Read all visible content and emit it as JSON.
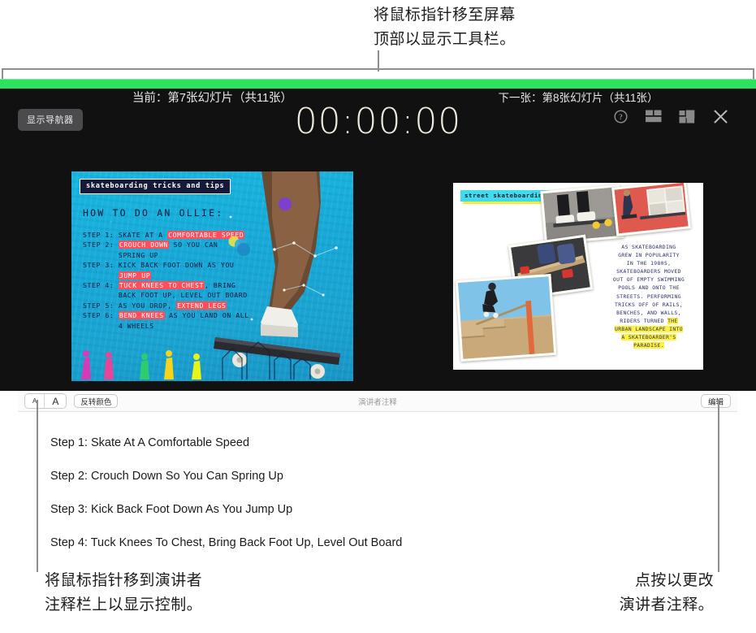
{
  "callouts": {
    "top": [
      "将鼠标指针移至屏幕",
      "顶部以显示工具栏。"
    ],
    "bottom_left": [
      "将鼠标指针移到演讲者",
      "注释栏上以显示控制。"
    ],
    "bottom_right": [
      "点按以更改",
      "演讲者注释。"
    ]
  },
  "toolbar": {
    "show_navigator_label": "显示导航器",
    "timer": "00:00:00",
    "icons": [
      {
        "name": "help-icon",
        "label": "帮助"
      },
      {
        "name": "layout-icon",
        "label": "布局"
      },
      {
        "name": "layout-options-icon",
        "label": "布局选项"
      },
      {
        "name": "close-icon",
        "label": "关闭"
      }
    ]
  },
  "slides": {
    "current_label": "当前：第7张幻灯片（共11张）",
    "next_label": "下一张：第8张幻灯片（共11张）",
    "current": {
      "title": "skateboarding tricks and tips",
      "heading": "HOW TO DO AN OLLIE:",
      "steps": [
        {
          "prefix": "STEP 1: ",
          "parts": [
            {
              "t": "SKATE AT A ",
              "hl": false
            },
            {
              "t": "COMFORTABLE SPEED",
              "hl": true
            }
          ]
        },
        {
          "prefix": "STEP 2: ",
          "parts": [
            {
              "t": "CROUCH DOWN",
              "hl": true
            },
            {
              "t": " SO YOU CAN",
              "hl": false
            }
          ]
        },
        {
          "prefix": "",
          "parts": [
            {
              "t": "SPRING UP",
              "hl": false
            }
          ]
        },
        {
          "prefix": "STEP 3: ",
          "parts": [
            {
              "t": "KICK BACK FOOT DOWN AS YOU",
              "hl": false
            }
          ]
        },
        {
          "prefix": "",
          "parts": [
            {
              "t": "JUMP UP",
              "hl": true
            }
          ]
        },
        {
          "prefix": "STEP 4: ",
          "parts": [
            {
              "t": "TUCK KNEES TO CHEST",
              "hl": true
            },
            {
              "t": ", BRING",
              "hl": false
            }
          ]
        },
        {
          "prefix": "",
          "parts": [
            {
              "t": "BACK FOOT UP, LEVEL OUT BOARD",
              "hl": false
            }
          ]
        },
        {
          "prefix": "STEP 5: ",
          "parts": [
            {
              "t": "AS YOU DROP, ",
              "hl": false
            },
            {
              "t": "EXTEND LEGS",
              "hl": true
            }
          ]
        },
        {
          "prefix": "STEP 6: ",
          "parts": [
            {
              "t": "BEND KNEES",
              "hl": true
            },
            {
              "t": " AS YOU LAND ON ALL",
              "hl": false
            }
          ]
        },
        {
          "prefix": "",
          "parts": [
            {
              "t": "4 WHEELS",
              "hl": false
            }
          ]
        }
      ]
    },
    "next": {
      "title": "street skateboarding",
      "body_lines": [
        {
          "t": "AS SKATEBOARDING",
          "hl": false
        },
        {
          "t": "GREW IN POPULARITY",
          "hl": false
        },
        {
          "t": "IN THE 1980S,",
          "hl": false
        },
        {
          "t": "SKATEBOARDERS MOVED",
          "hl": false
        },
        {
          "t": "OUT OF EMPTY SWIMMING",
          "hl": false
        },
        {
          "t": "POOLS AND ONTO THE",
          "hl": false
        },
        {
          "t": "STREETS. PERFORMING",
          "hl": false
        },
        {
          "t": "TRICKS OFF OF RAILS,",
          "hl": false
        },
        {
          "t": "BENCHES, AND WALLS,",
          "hl": false
        },
        {
          "t": "RIDERS TURNED THE",
          "hl": "partial"
        },
        {
          "t": "URBAN LANDSCAPE INTO",
          "hl": true
        },
        {
          "t": "A SKATEBOARDER'S",
          "hl": true
        },
        {
          "t": "PARADISE.",
          "hl": true
        }
      ]
    }
  },
  "notes": {
    "panel_title": "演讲者注释",
    "decrease_font_label": "A",
    "increase_font_label": "A",
    "invert_colors_label": "反转颜色",
    "edit_label": "编辑",
    "lines": [
      "Step 1: Skate At A Comfortable Speed",
      "Step 2: Crouch Down So You Can Spring Up",
      "Step 3: Kick Back Foot Down As You Jump Up",
      "Step 4: Tuck Knees To Chest, Bring Back Foot Up, Level Out Board"
    ]
  },
  "colors": {
    "accent_green": "#2ee05e",
    "screen_background": "#111112",
    "timer_text": "#efeade",
    "slide_highlight_red": "#ff4d5a",
    "slide_highlight_yellow": "#fff23d",
    "slide_highlight_cyan": "#3fdcf0"
  }
}
